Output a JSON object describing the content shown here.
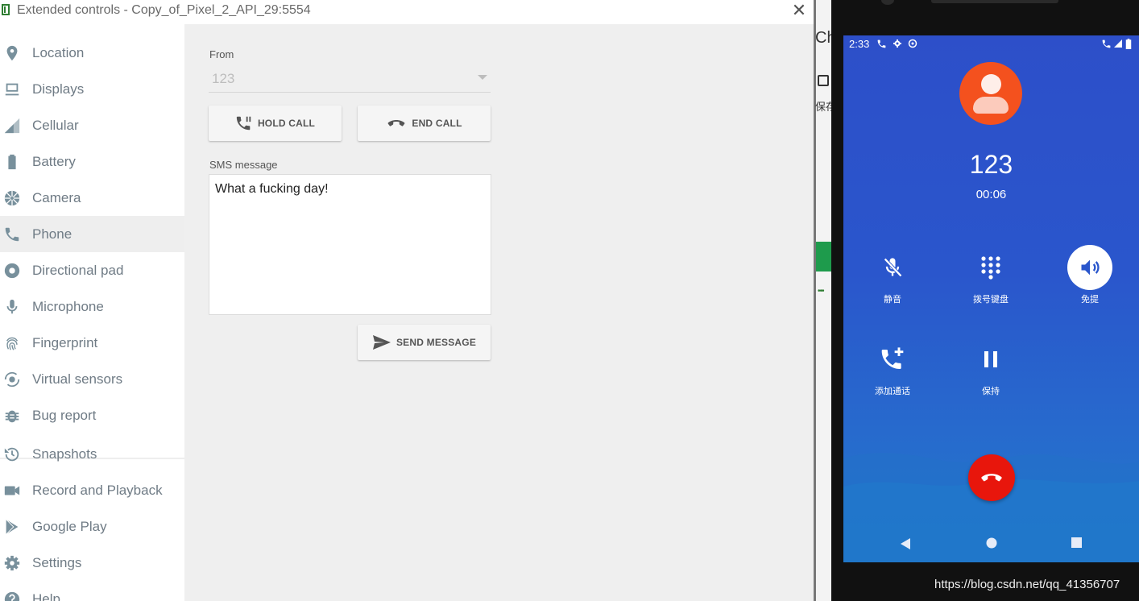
{
  "window": {
    "title": "Extended controls - Copy_of_Pixel_2_API_29:5554",
    "close_glyph": "✕"
  },
  "sidebar": {
    "items": [
      {
        "label": "Location",
        "icon": "location-pin-icon"
      },
      {
        "label": "Displays",
        "icon": "display-icon"
      },
      {
        "label": "Cellular",
        "icon": "cellular-signal-icon"
      },
      {
        "label": "Battery",
        "icon": "battery-icon"
      },
      {
        "label": "Camera",
        "icon": "camera-aperture-icon"
      },
      {
        "label": "Phone",
        "icon": "phone-icon",
        "selected": true
      },
      {
        "label": "Directional pad",
        "icon": "dpad-icon"
      },
      {
        "label": "Microphone",
        "icon": "microphone-icon"
      },
      {
        "label": "Fingerprint",
        "icon": "fingerprint-icon"
      },
      {
        "label": "Virtual sensors",
        "icon": "rotation-icon"
      },
      {
        "label": "Bug report",
        "icon": "bug-icon"
      },
      {
        "label": "Snapshots",
        "icon": "history-icon"
      },
      {
        "label": "Record and Playback",
        "icon": "video-camera-icon"
      },
      {
        "label": "Google Play",
        "icon": "play-store-icon"
      },
      {
        "label": "Settings",
        "icon": "gear-icon"
      },
      {
        "label": "Help",
        "icon": "help-icon"
      }
    ]
  },
  "phone_panel": {
    "from_label": "From",
    "from_value": "123",
    "hold_button": "HOLD CALL",
    "end_button": "END CALL",
    "sms_label": "SMS message",
    "sms_text": "What a fucking day!",
    "send_button": "SEND MESSAGE"
  },
  "background_window": {
    "text_ch": "Ch",
    "text_bao": "保存"
  },
  "emulator": {
    "status_time": "2:33",
    "caller": "123",
    "timer": "00:06",
    "controls": {
      "mute": "静音",
      "keypad": "拨号键盘",
      "speaker": "免提",
      "add_call": "添加通话",
      "hold": "保持"
    },
    "colors": {
      "avatar": "#f4511e",
      "end_call": "#e8160c",
      "screen": "#2a56cc"
    }
  },
  "watermark": "https://blog.csdn.net/qq_41356707"
}
